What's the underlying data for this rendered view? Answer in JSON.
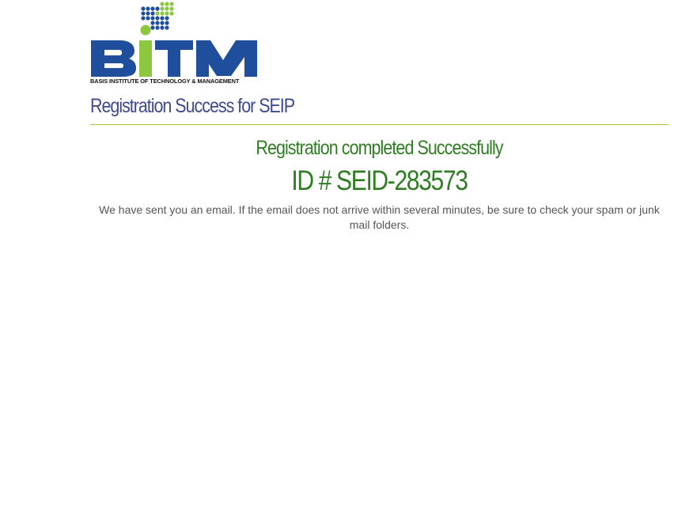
{
  "logo": {
    "wordmark": "BITM",
    "tagline": "BASIS INSTITUTE OF TECHNOLOGY & MANAGEMENT",
    "brand_blue": "#1f4e9c",
    "brand_green": "#8dc63f"
  },
  "page": {
    "title": "Registration Success for SEIP",
    "rule_color": "#a6c63a"
  },
  "result": {
    "heading": "Registration completed Successfully",
    "id_line": "ID # SEID-283573",
    "message": "We have sent you an email. If the email does not arrive within several minutes, be sure to check your spam or junk mail folders.",
    "accent_color": "#2e7d22"
  }
}
